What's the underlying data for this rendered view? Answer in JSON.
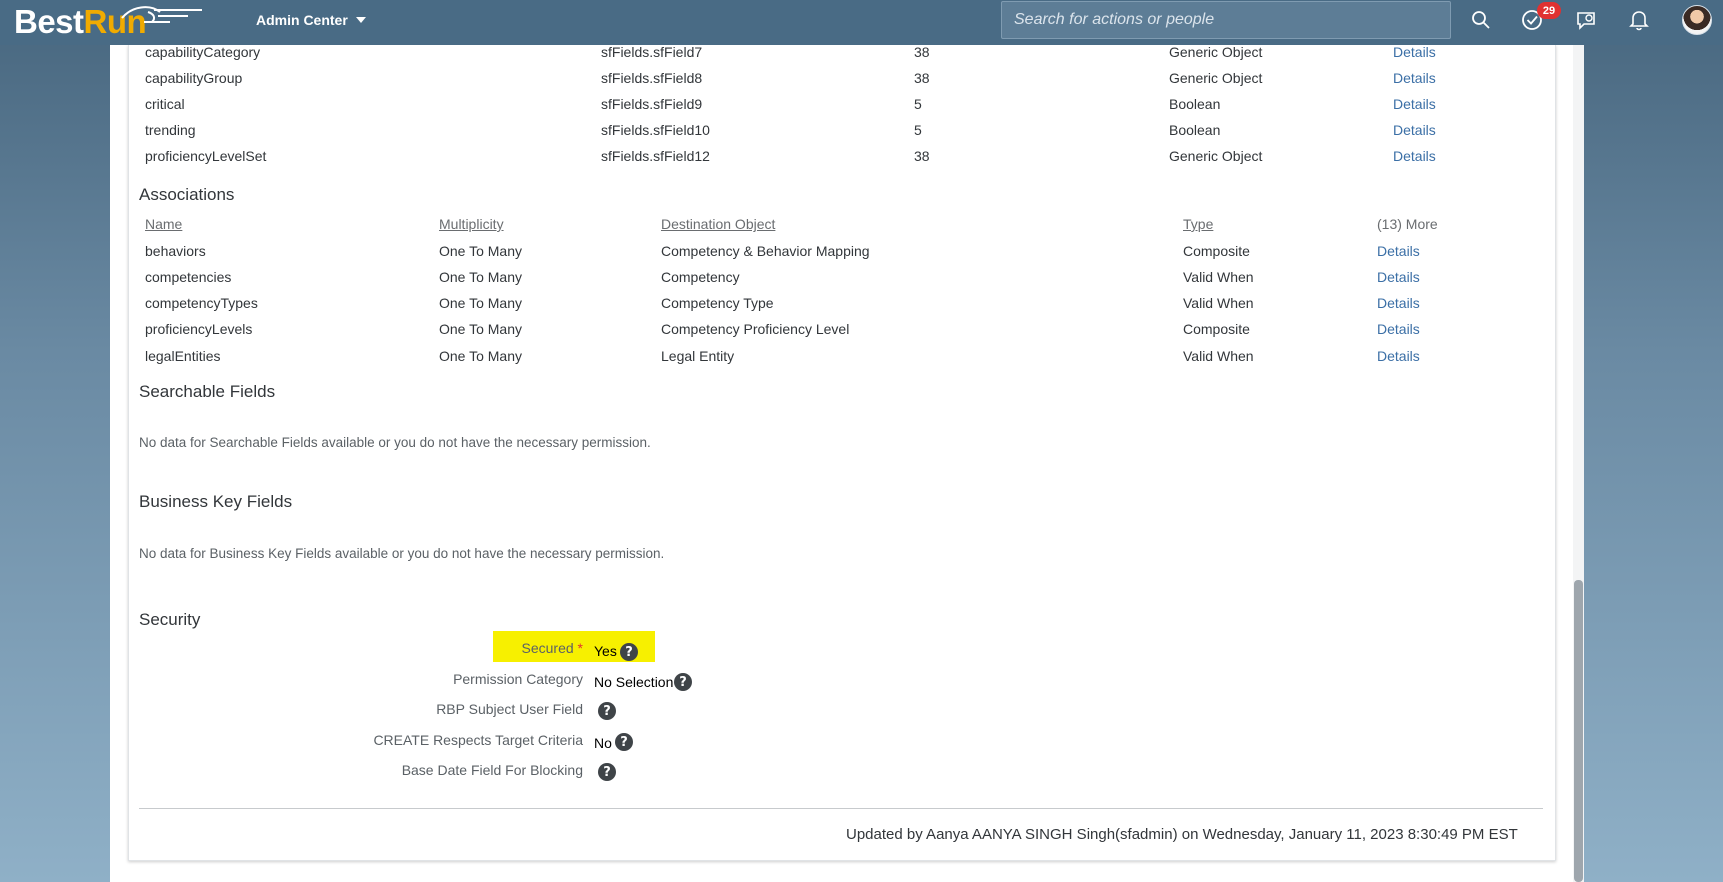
{
  "shell": {
    "logo_best": "Best",
    "logo_run": "Run",
    "admin_center": "Admin Center",
    "search_placeholder": "Search for actions or people",
    "notifications_badge": "29"
  },
  "fields": [
    {
      "name": "capabilityCategory",
      "db_field": "sfFields.sfField7",
      "length": "38",
      "type": "Generic Object",
      "action": "Details"
    },
    {
      "name": "capabilityGroup",
      "db_field": "sfFields.sfField8",
      "length": "38",
      "type": "Generic Object",
      "action": "Details"
    },
    {
      "name": "critical",
      "db_field": "sfFields.sfField9",
      "length": "5",
      "type": "Boolean",
      "action": "Details"
    },
    {
      "name": "trending",
      "db_field": "sfFields.sfField10",
      "length": "5",
      "type": "Boolean",
      "action": "Details"
    },
    {
      "name": "proficiencyLevelSet",
      "db_field": "sfFields.sfField12",
      "length": "38",
      "type": "Generic Object",
      "action": "Details"
    }
  ],
  "associations": {
    "title": "Associations",
    "headers": {
      "name": "Name",
      "multiplicity": "Multiplicity",
      "destination": "Destination Object",
      "type": "Type",
      "more": "(13) More"
    },
    "rows": [
      {
        "name": "behaviors",
        "multiplicity": "One To Many",
        "destination": "Competency & Behavior Mapping",
        "type": "Composite",
        "action": "Details"
      },
      {
        "name": "competencies",
        "multiplicity": "One To Many",
        "destination": "Competency",
        "type": "Valid When",
        "action": "Details"
      },
      {
        "name": "competencyTypes",
        "multiplicity": "One To Many",
        "destination": "Competency Type",
        "type": "Valid When",
        "action": "Details"
      },
      {
        "name": "proficiencyLevels",
        "multiplicity": "One To Many",
        "destination": "Competency Proficiency Level",
        "type": "Composite",
        "action": "Details"
      },
      {
        "name": "legalEntities",
        "multiplicity": "One To Many",
        "destination": "Legal Entity",
        "type": "Valid When",
        "action": "Details"
      }
    ]
  },
  "searchable": {
    "title": "Searchable Fields",
    "message": "No data for Searchable Fields available or you do not have the necessary permission."
  },
  "business_key": {
    "title": "Business Key Fields",
    "message": "No data for Business Key Fields available or you do not have the necessary permission."
  },
  "security": {
    "title": "Security",
    "secured_label": "Secured",
    "required_mark": "*",
    "secured_value": "Yes",
    "permission_label": "Permission Category",
    "permission_value": "No Selection",
    "rbp_label": "RBP Subject User Field",
    "create_label": "CREATE Respects Target Criteria",
    "create_value": "No",
    "base_date_label": "Base Date Field For Blocking",
    "highlight_color": "#f7f000"
  },
  "footer": {
    "updated_text": "Updated by Aanya AANYA SINGH Singh(sfadmin) on Wednesday, January 11, 2023 8:30:49 PM EST"
  }
}
